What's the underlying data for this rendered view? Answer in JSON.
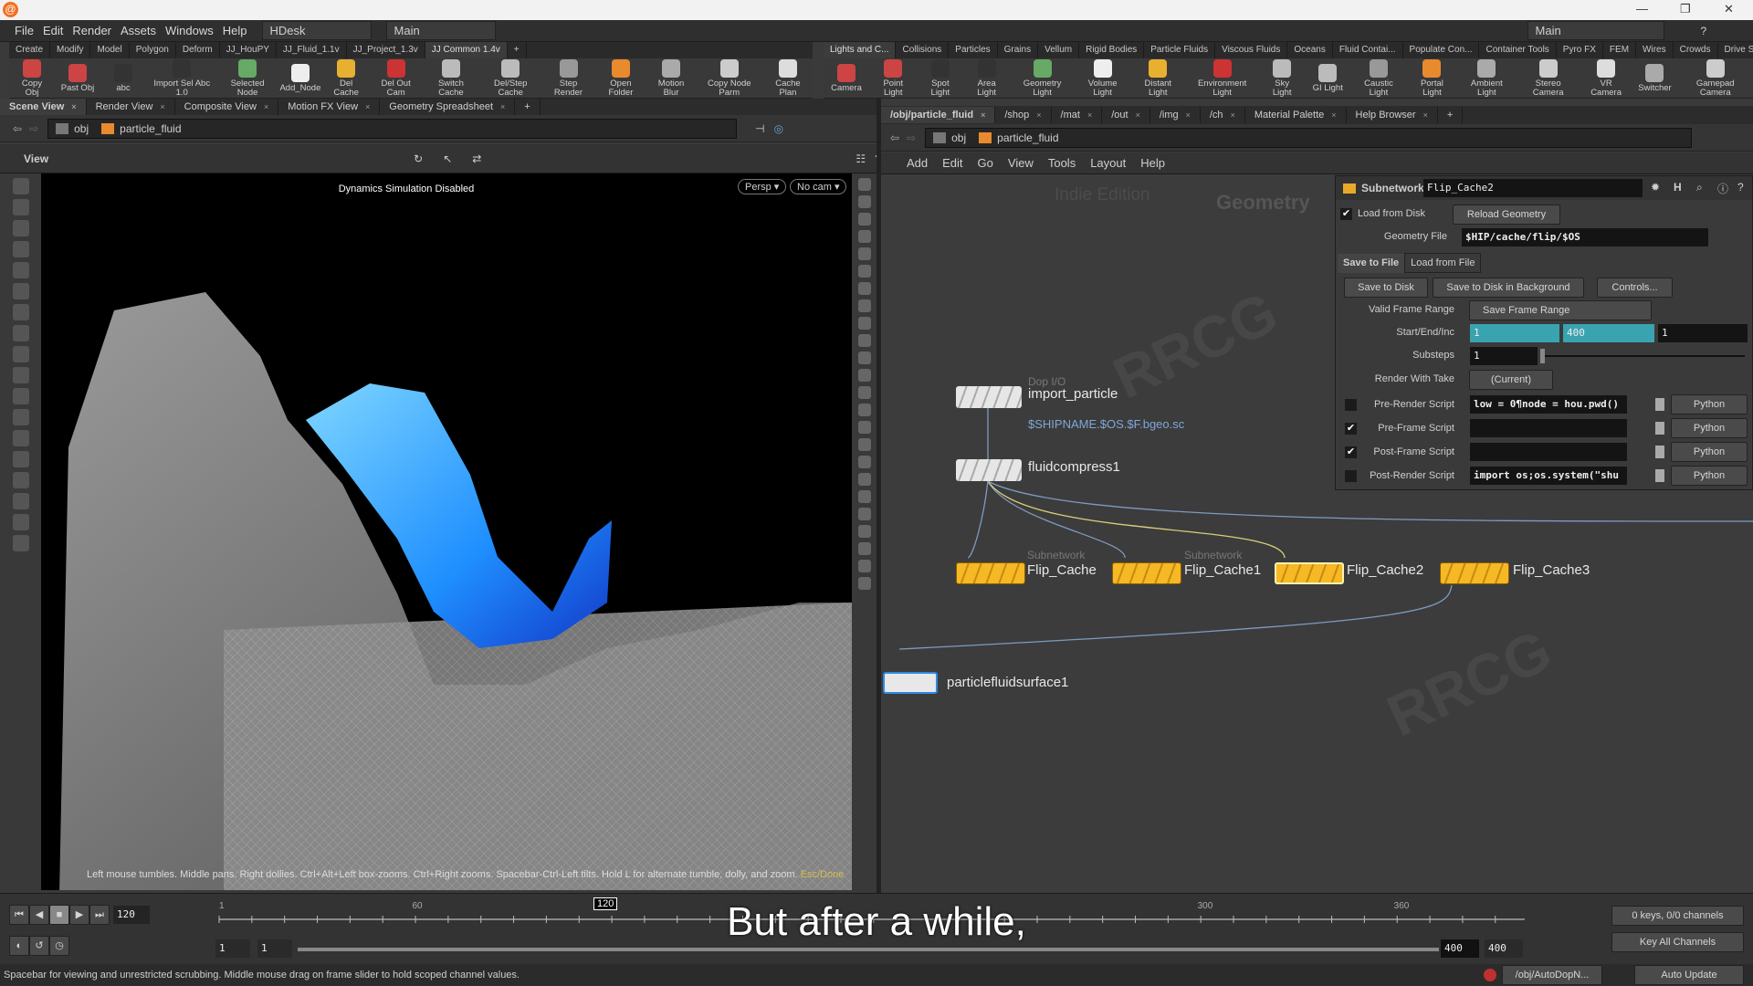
{
  "menu": {
    "items": [
      "File",
      "Edit",
      "Render",
      "Assets",
      "Windows",
      "Help"
    ],
    "desktop": "HDesk",
    "context": "Main",
    "right_context": "Main"
  },
  "shelf_left": {
    "tabs": [
      "Create",
      "Modify",
      "Model",
      "Polygon",
      "Deform",
      "JJ_HouPY",
      "JJ_Fluid_1.1v",
      "JJ_Project_1.3v",
      "JJ Common 1.4v"
    ],
    "active": 8,
    "tools": [
      "Copy Obj",
      "Past Obj",
      "abc",
      "Import Sel Abc 1.0",
      "Selected Node",
      "Add_Node",
      "Del Cache",
      "Del Out Cam",
      "Switch Cache",
      "Del/Step Cache",
      "Step Render",
      "Open Folder",
      "Motion Blur",
      "Copy Node Parm",
      "Cache Plan"
    ]
  },
  "shelf_right": {
    "tabs": [
      "Lights and C...",
      "Collisions",
      "Particles",
      "Grains",
      "Vellum",
      "Rigid Bodies",
      "Particle Fluids",
      "Viscous Fluids",
      "Oceans",
      "Fluid Contai...",
      "Populate Con...",
      "Container Tools",
      "Pyro FX",
      "FEM",
      "Wires",
      "Crowds",
      "Drive Simula..."
    ],
    "active": 0,
    "tools": [
      "Camera",
      "Point Light",
      "Spot Light",
      "Area Light",
      "Geometry Light",
      "Volume Light",
      "Distant Light",
      "Environment Light",
      "Sky Light",
      "GI Light",
      "Caustic Light",
      "Portal Light",
      "Ambient Light",
      "Stereo Camera",
      "VR Camera",
      "Switcher",
      "Gamepad Camera"
    ]
  },
  "left_pane": {
    "tabs": [
      "Scene View",
      "Render View",
      "Composite View",
      "Motion FX View",
      "Geometry Spreadsheet"
    ],
    "path": [
      "obj",
      "particle_fluid"
    ],
    "view_label": "View",
    "status": "Dynamics Simulation Disabled",
    "persp": "Persp ▾",
    "cam": "No cam ▾",
    "hint": "Left mouse tumbles. Middle pans. Right dollies. Ctrl+Alt+Left box-zooms. Ctrl+Right zooms. Spacebar-Ctrl-Left tilts. Hold L for alternate tumble, dolly, and zoom.",
    "hint_tail": "Esc/Done"
  },
  "right_pane": {
    "tabs": [
      "/obj/particle_fluid",
      "/shop",
      "/mat",
      "/out",
      "/img",
      "/ch",
      "Material Palette",
      "Help Browser"
    ],
    "path": [
      "obj",
      "particle_fluid"
    ],
    "menu": [
      "Add",
      "Edit",
      "Go",
      "View",
      "Tools",
      "Layout",
      "Help"
    ],
    "edition": "Indie Edition",
    "context": "Geometry"
  },
  "network": {
    "nodes": [
      {
        "name": "import_particle",
        "type": "Dop I/O",
        "note": "$SHIPNAME.$OS.$F.bgeo.sc"
      },
      {
        "name": "fluidcompress1",
        "type": ""
      },
      {
        "name": "Flip_Cache",
        "type": "Subnetwork"
      },
      {
        "name": "Flip_Cache1",
        "type": "Subnetwork"
      },
      {
        "name": "Flip_Cache2",
        "type": ""
      },
      {
        "name": "Flip_Cache3",
        "type": ""
      },
      {
        "name": "particlefluidsurface1",
        "type": ""
      }
    ]
  },
  "params": {
    "node_type": "Subnetwork",
    "node_name": "Flip_Cache2",
    "load_from_disk": {
      "label": "Load from Disk",
      "checked": true
    },
    "reload": "Reload Geometry",
    "geometry_file": {
      "label": "Geometry File",
      "value": "$HIP/cache/flip/$OS"
    },
    "tabs": [
      "Save to File",
      "Load from File"
    ],
    "buttons": [
      "Save to Disk",
      "Save to Disk in Background",
      "Controls..."
    ],
    "valid_frame_range": {
      "label": "Valid Frame Range",
      "value": "Save Frame Range"
    },
    "start_end_inc": {
      "label": "Start/End/Inc",
      "start": "1",
      "end": "400",
      "inc": "1"
    },
    "substeps": {
      "label": "Substeps",
      "value": "1"
    },
    "render_with_take": {
      "label": "Render With Take",
      "value": "(Current)"
    },
    "scripts": [
      {
        "label": "Pre-Render Script",
        "checked": false,
        "value": "low = 0¶node = hou.pwd()",
        "lang": "Python"
      },
      {
        "label": "Pre-Frame Script",
        "checked": true,
        "value": "",
        "lang": "Python"
      },
      {
        "label": "Post-Frame Script",
        "checked": true,
        "value": "",
        "lang": "Python"
      },
      {
        "label": "Post-Render Script",
        "checked": false,
        "value": "import os;os.system(\"shu",
        "lang": "Python"
      }
    ]
  },
  "timeline": {
    "frame": "120",
    "marker": "120",
    "ticks": [
      "1",
      "60",
      "300",
      "360"
    ],
    "range_start": "1",
    "range_start2": "1",
    "range_end": "400",
    "range_end2": "400",
    "keys": "0 keys, 0/0 channels",
    "key_all": "Key All Channels"
  },
  "subtitle": "But after a while,",
  "status": {
    "text": "Spacebar for viewing and unrestricted scrubbing. Middle mouse drag on frame slider to hold scoped channel values.",
    "dop": "/obj/AutoDopN...",
    "update": "Auto Update"
  },
  "colors": {
    "accent": "#3aa3b0",
    "node_yellow": "#f6b824",
    "fluid_blue": "#1f8fff"
  }
}
